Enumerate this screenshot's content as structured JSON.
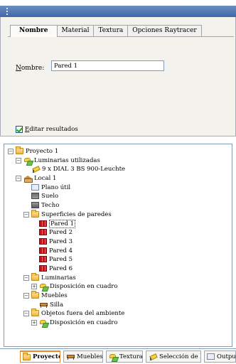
{
  "properties": {
    "tabs": [
      {
        "label": "Nombre"
      },
      {
        "label": "Material"
      },
      {
        "label": "Textura"
      },
      {
        "label": "Opciones Raytracer"
      }
    ],
    "active_tab": "Nombre",
    "name_field": {
      "label_prefix": "N",
      "label_rest": "ombre:",
      "value": "Pared 1"
    },
    "edit_results": {
      "label_prefix": "E",
      "label_rest": "ditar resultados",
      "checked": true
    }
  },
  "tree": {
    "items": [
      {
        "label": "Proyecto 1",
        "icon": "folder-icon",
        "expander": "−"
      },
      {
        "label": "Luminarias utilizadas",
        "icon": "luminaire-icon",
        "expander": "−"
      },
      {
        "label": "9 x DIAL 3 BS 900-Leuchte",
        "icon": "lamp-icon",
        "expander": ""
      },
      {
        "label": "Local 1",
        "icon": "room-icon",
        "expander": "−"
      },
      {
        "label": "Plano útil",
        "icon": "work-plane-icon",
        "expander": ""
      },
      {
        "label": "Suelo",
        "icon": "floor-icon",
        "expander": ""
      },
      {
        "label": "Techo",
        "icon": "ceiling-icon",
        "expander": ""
      },
      {
        "label": "Superficies de paredes",
        "icon": "folder-icon",
        "expander": "−"
      },
      {
        "label": "Pared 1",
        "icon": "wall-icon",
        "expander": "",
        "selected": true
      },
      {
        "label": "Pared 2",
        "icon": "wall-icon",
        "expander": ""
      },
      {
        "label": "Pared 3",
        "icon": "wall-icon",
        "expander": ""
      },
      {
        "label": "Pared 4",
        "icon": "wall-icon",
        "expander": ""
      },
      {
        "label": "Pared 5",
        "icon": "wall-icon",
        "expander": ""
      },
      {
        "label": "Pared 6",
        "icon": "wall-icon",
        "expander": ""
      },
      {
        "label": "Luminarias",
        "icon": "folder-icon",
        "expander": "−"
      },
      {
        "label": "Disposición en cuadro",
        "icon": "luminaire-icon",
        "expander": "+"
      },
      {
        "label": "Muebles",
        "icon": "folder-icon",
        "expander": "−"
      },
      {
        "label": "Silla",
        "icon": "chair-icon",
        "expander": ""
      },
      {
        "label": "Objetos fuera del ambiente",
        "icon": "folder-icon",
        "expander": "−"
      },
      {
        "label": "Disposición en cuadro",
        "icon": "luminaire-icon",
        "expander": "+"
      }
    ]
  },
  "bottom_tabs": [
    {
      "label": "Proyecto",
      "icon": "folder-icon",
      "active": true
    },
    {
      "label": "Muebles",
      "icon": "chair-icon"
    },
    {
      "label": "Texturas",
      "icon": "textures-icon"
    },
    {
      "label": "Selección de l...",
      "icon": "lamp-icon"
    },
    {
      "label": "Output",
      "icon": "output-icon"
    }
  ],
  "colors": {
    "titlebar": "#3f66a8",
    "panel_bg": "#f3f2ec",
    "accent_tab": "#e68b2c",
    "wall_icon": "#c0141b"
  }
}
